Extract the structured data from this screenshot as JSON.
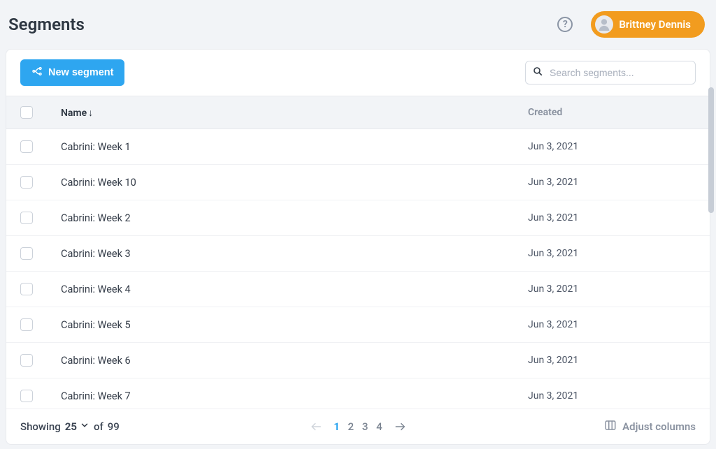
{
  "header": {
    "title": "Segments",
    "user_name": "Brittney Dennis"
  },
  "toolbar": {
    "new_segment_label": "New segment",
    "search_placeholder": "Search segments..."
  },
  "columns": {
    "name": "Name",
    "created": "Created"
  },
  "rows": [
    {
      "name": "Cabrini: Week 1",
      "created": "Jun 3, 2021"
    },
    {
      "name": "Cabrini: Week 10",
      "created": "Jun 3, 2021"
    },
    {
      "name": "Cabrini: Week 2",
      "created": "Jun 3, 2021"
    },
    {
      "name": "Cabrini: Week 3",
      "created": "Jun 3, 2021"
    },
    {
      "name": "Cabrini: Week 4",
      "created": "Jun 3, 2021"
    },
    {
      "name": "Cabrini: Week 5",
      "created": "Jun 3, 2021"
    },
    {
      "name": "Cabrini: Week 6",
      "created": "Jun 3, 2021"
    },
    {
      "name": "Cabrini: Week 7",
      "created": "Jun 3, 2021"
    }
  ],
  "footer": {
    "showing_label": "Showing",
    "page_size": "25",
    "of_label": "of",
    "total": "99",
    "pages": [
      "1",
      "2",
      "3",
      "4"
    ],
    "current_page": "1",
    "adjust_columns_label": "Adjust columns"
  }
}
